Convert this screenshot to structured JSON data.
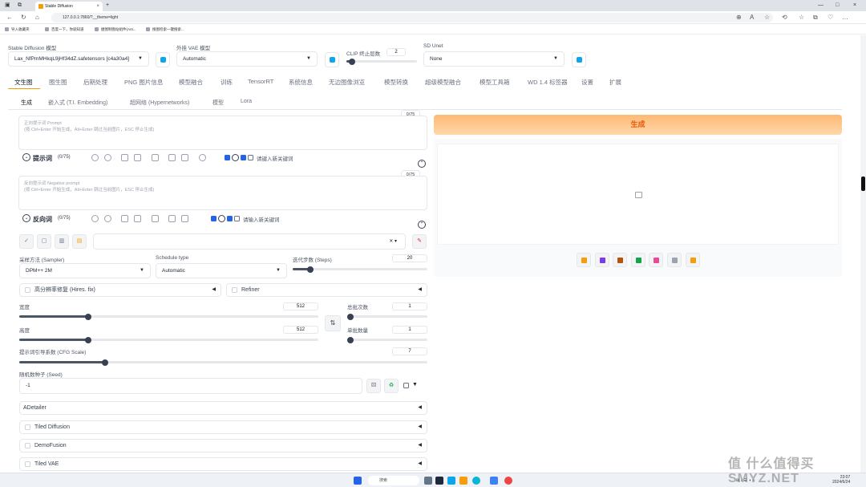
{
  "browser": {
    "tab_title": "Stable Diffusion",
    "url": "127.0.0.1:7860/?__theme=light",
    "bookmarks": [
      "导入收藏夹",
      "百度一下，你就知道",
      "捷图制图站组件(Ant...",
      "搜图检索一键搜索..."
    ]
  },
  "header": {
    "model_label": "Stable Diffusion 模型",
    "model_value": "Lax_NfPmMHkqL9jHf34dZ.safetensors [c4a30a4]",
    "vae_label": "外挂 VAE 模型",
    "vae_value": "Automatic",
    "clip_label": "CLIP 终止层数",
    "clip_value": "2",
    "clip_level": 0.083,
    "unet_label": "SD Unet",
    "unet_value": "None"
  },
  "main_tabs": [
    "文生图",
    "图生图",
    "后期处理",
    "PNG 图片信息",
    "模型融合",
    "训练",
    "TensorRT",
    "系统信息",
    "无边图像浏览",
    "模型转换",
    "超级模型融合",
    "模型工具箱",
    "WD 1.4 标签器",
    "设置",
    "扩展"
  ],
  "sub_tabs": [
    "生成",
    "嵌入式 (T.I. Embedding)",
    "超网络 (Hypernetworks)",
    "模型",
    "Lora"
  ],
  "prompt": {
    "placeholder_line1": "正向提示词 Prompt",
    "placeholder_line2": "(按 Ctrl+Enter 开始生成，Alt+Enter 跳过当前图片，ESC 停止生成)",
    "counter": "0/75",
    "label": "提示词",
    "token_count": "(0/75)",
    "keyword_placeholder": "请键入新关键词"
  },
  "negative": {
    "placeholder_line1": "反向提示词 Negative prompt",
    "placeholder_line2": "(按 Ctrl+Enter 开始生成，Alt+Enter 跳过当前图片，ESC 停止生成)",
    "counter": "0/75",
    "label": "反向词",
    "token_count": "(0/75)",
    "keyword_placeholder": "请输入新关键词"
  },
  "generate_label": "生成",
  "params": {
    "sampler_label": "采样方法 (Sampler)",
    "sampler_value": "DPM++ 2M",
    "schedule_label": "Schedule type",
    "schedule_value": "Automatic",
    "steps_label": "迭代步数 (Steps)",
    "steps_value": "20",
    "steps_level": 0.13,
    "hires_label": "高分辨率修复 (Hires. fix)",
    "refiner_label": "Refiner",
    "width_label": "宽度",
    "width_value": "512",
    "width_level": 0.23,
    "height_label": "高度",
    "height_value": "512",
    "height_level": 0.23,
    "batch_count_label": "总批次数",
    "batch_count_value": "1",
    "batch_count_level": 0.0,
    "batch_size_label": "单批数量",
    "batch_size_value": "1",
    "batch_size_level": 0.0,
    "cfg_label": "提示词引导系数 (CFG Scale)",
    "cfg_value": "7",
    "cfg_level": 0.21,
    "seed_label": "随机数种子 (Seed)",
    "seed_value": "-1",
    "swap_glyph": "⇅"
  },
  "accordions": [
    "ADetailer",
    "Tiled Diffusion",
    "DemoFusion",
    "Tiled VAE"
  ],
  "icons": {
    "tool_buttons": [
      "edit-icon",
      "copy-icon",
      "trash-icon",
      "clipboard-icon"
    ],
    "output_buttons": [
      "folder-icon",
      "save-icon",
      "zip-icon",
      "image-icon",
      "palette-icon",
      "ruler-icon",
      "sparkle-icon"
    ]
  },
  "colors": {
    "generate_bg": "#fdba74",
    "generate_text": "#ea580c",
    "refresh_icon": "#0ea5e9",
    "checkbox": "#2563eb"
  },
  "taskbar": {
    "search_placeholder": "搜索",
    "time": "23:07",
    "date": "2024/6/24"
  },
  "watermark": "值 什么值得买 SMYZ.NET"
}
